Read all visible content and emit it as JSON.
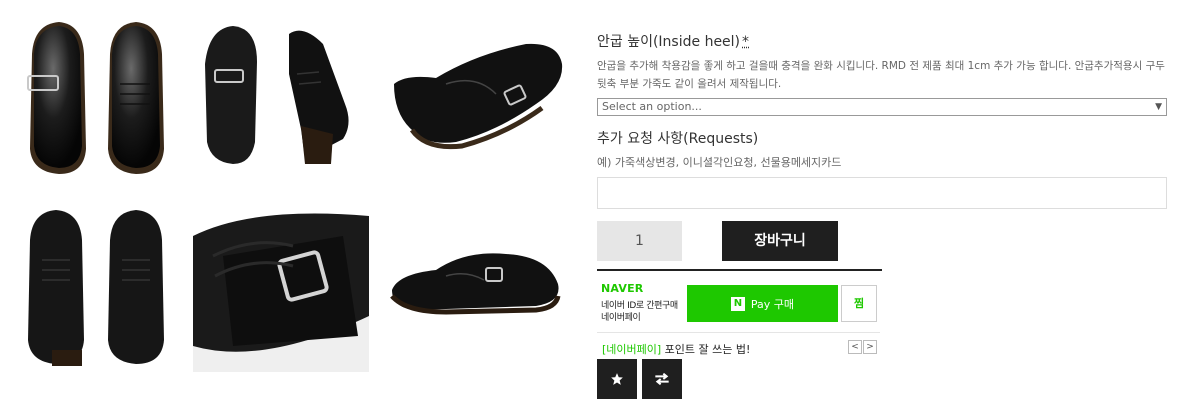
{
  "gallery": {
    "images": [
      {
        "name": "pair top view"
      },
      {
        "name": "pair side view"
      },
      {
        "name": "single shoe side view"
      },
      {
        "name": "pair top view alternate"
      },
      {
        "name": "buckle strap close-up"
      },
      {
        "name": "single shoe angled view"
      }
    ]
  },
  "option": {
    "title": "안굽 높이(Inside heel)",
    "required_mark": "*",
    "description": "안굽을 추가해 착용감을 좋게 하고 걸을때 충격을 완화 시킵니다. RMD 전 제품 최대 1cm 추가 가능 합니다. 안굽추가적용시 구두 뒷축 부분 가죽도 같이 올려서 제작됩니다.",
    "select_value": "Select an option..."
  },
  "requests": {
    "title": "추가 요청 사항(Requests)",
    "hint": "예) 가죽색상변경, 이니셜각인요청, 선물용메세지카드",
    "value": ""
  },
  "purchase": {
    "quantity": "1",
    "cart_label": "장바구니"
  },
  "naver_pay": {
    "logo": "NAVER",
    "line1": "네이버 ID로 간편구매",
    "line2": "네이버페이",
    "n_mark": "N",
    "pay_label": "Pay 구매",
    "zzim_label": "찜",
    "promo_highlight": "[네이버페이]",
    "promo_text": " 포인트 잘 쓰는 법!",
    "prev_arrow": "<",
    "next_arrow": ">"
  },
  "actions": {
    "wishlist_icon": "star-icon",
    "compare_icon": "swap-icon"
  },
  "colors": {
    "naver_green": "#1ec800",
    "dark_button": "#1f1f1f"
  }
}
